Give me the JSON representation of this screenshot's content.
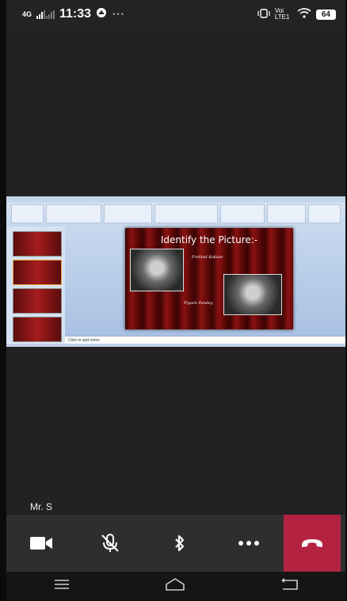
{
  "status_bar": {
    "network": "4G",
    "time": "11:33",
    "more": "···",
    "carrier": "Voi LTE1",
    "battery": "64"
  },
  "screenshare": {
    "slide_title": "Identify the Picture:-",
    "caption_1": "Prahlad Kakkar",
    "caption_2": "Piyush Pandey",
    "notes_placeholder": "Click to add notes"
  },
  "participant": {
    "name": "Mr. S"
  },
  "controls": {
    "camera": "video-camera-icon",
    "mic": "microphone-muted-icon",
    "bluetooth": "bluetooth-icon",
    "more": "more-options-icon",
    "end_call": "end-call-icon",
    "end_call_color": "#b3223e"
  },
  "nav_bar": {
    "recents": "recents-icon",
    "home": "home-icon",
    "back": "back-icon"
  }
}
